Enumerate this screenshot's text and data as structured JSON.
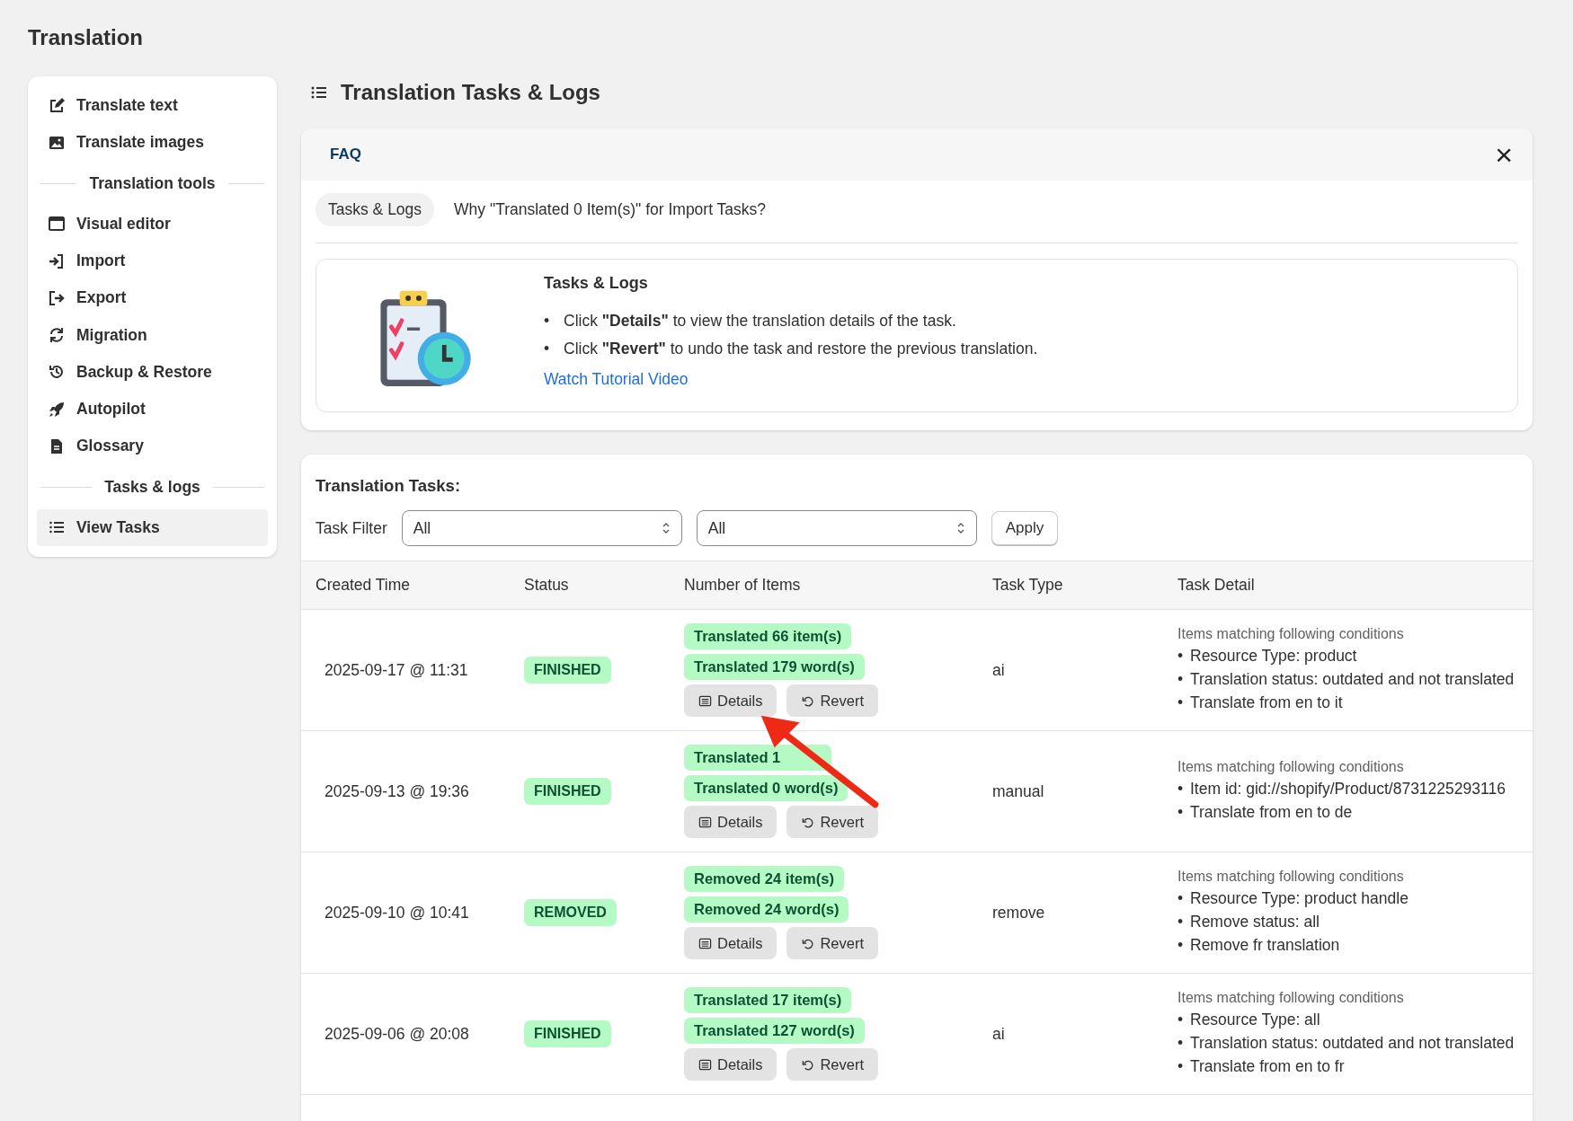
{
  "page_title": "Translation",
  "bullet": "•",
  "sidebar": {
    "items": [
      {
        "kind": "item",
        "label": "Translate text",
        "selected": false
      },
      {
        "kind": "item",
        "label": "Translate images",
        "selected": false
      },
      {
        "kind": "section",
        "label": "Translation tools"
      },
      {
        "kind": "item",
        "label": "Visual editor",
        "selected": false
      },
      {
        "kind": "item",
        "label": "Import",
        "selected": false
      },
      {
        "kind": "item",
        "label": "Export",
        "selected": false
      },
      {
        "kind": "item",
        "label": "Migration",
        "selected": false
      },
      {
        "kind": "item",
        "label": "Backup & Restore",
        "selected": false
      },
      {
        "kind": "item",
        "label": "Autopilot",
        "selected": false
      },
      {
        "kind": "item",
        "label": "Glossary",
        "selected": false
      },
      {
        "kind": "section",
        "label": "Tasks & logs"
      },
      {
        "kind": "item",
        "label": "View Tasks",
        "selected": true
      }
    ]
  },
  "heading": "Translation Tasks & Logs",
  "faq": {
    "title": "FAQ",
    "close": "×",
    "tabs": [
      {
        "label": "Tasks & Logs",
        "selected": true
      },
      {
        "label": "Why \"Translated 0 Item(s)\" for Import Tasks?",
        "selected": false
      }
    ],
    "panel": {
      "title": "Tasks & Logs",
      "bullets": [
        "Click **\"Details\"** to view the translation details of the task.",
        "Click **\"Revert\"** to undo the task and restore the previous translation."
      ],
      "link": "Watch Tutorial Video"
    }
  },
  "tasks": {
    "title": "Translation Tasks:",
    "filter_label": "Task Filter",
    "filters": [
      {
        "value": "All"
      },
      {
        "value": "All"
      }
    ],
    "apply": "Apply",
    "columns": [
      "Created Time",
      "Status",
      "Number of Items",
      "Task Type",
      "Task Detail"
    ],
    "rows": [
      {
        "time": "2025-09-17 @ 11:31",
        "status": "FINISHED",
        "counts": [
          "Translated 66 item(s)",
          "Translated 179 word(s)"
        ],
        "buttons": [
          "Details",
          "Revert"
        ],
        "type": "ai",
        "detail_heading": "Items matching following conditions",
        "detail": [
          "Resource Type: product",
          "Translation status: outdated and not translated",
          "Translate from en to it"
        ]
      },
      {
        "time": "2025-09-13 @ 19:36",
        "status": "FINISHED",
        "counts": [
          "Translated 1",
          "Translated 0 word(s)"
        ],
        "buttons": [
          "Details",
          "Revert"
        ],
        "type": "manual",
        "detail_heading": "Items matching following conditions",
        "detail": [
          "Item id: gid://shopify/Product/8731225293116",
          "Translate from en to de"
        ]
      },
      {
        "time": "2025-09-10 @ 10:41",
        "status": "REMOVED",
        "counts": [
          "Removed 24 item(s)",
          "Removed 24 word(s)"
        ],
        "buttons": [
          "Details",
          "Revert"
        ],
        "type": "remove",
        "detail_heading": "Items matching following conditions",
        "detail": [
          "Resource Type: product handle",
          "Remove status: all",
          "Remove fr translation"
        ]
      },
      {
        "time": "2025-09-06 @ 20:08",
        "status": "FINISHED",
        "counts": [
          "Translated 17 item(s)",
          "Translated 127 word(s)"
        ],
        "buttons": [
          "Details",
          "Revert"
        ],
        "type": "ai",
        "detail_heading": "Items matching following conditions",
        "detail": [
          "Resource Type: all",
          "Translation status: outdated and not translated",
          "Translate from en to fr"
        ]
      }
    ]
  }
}
